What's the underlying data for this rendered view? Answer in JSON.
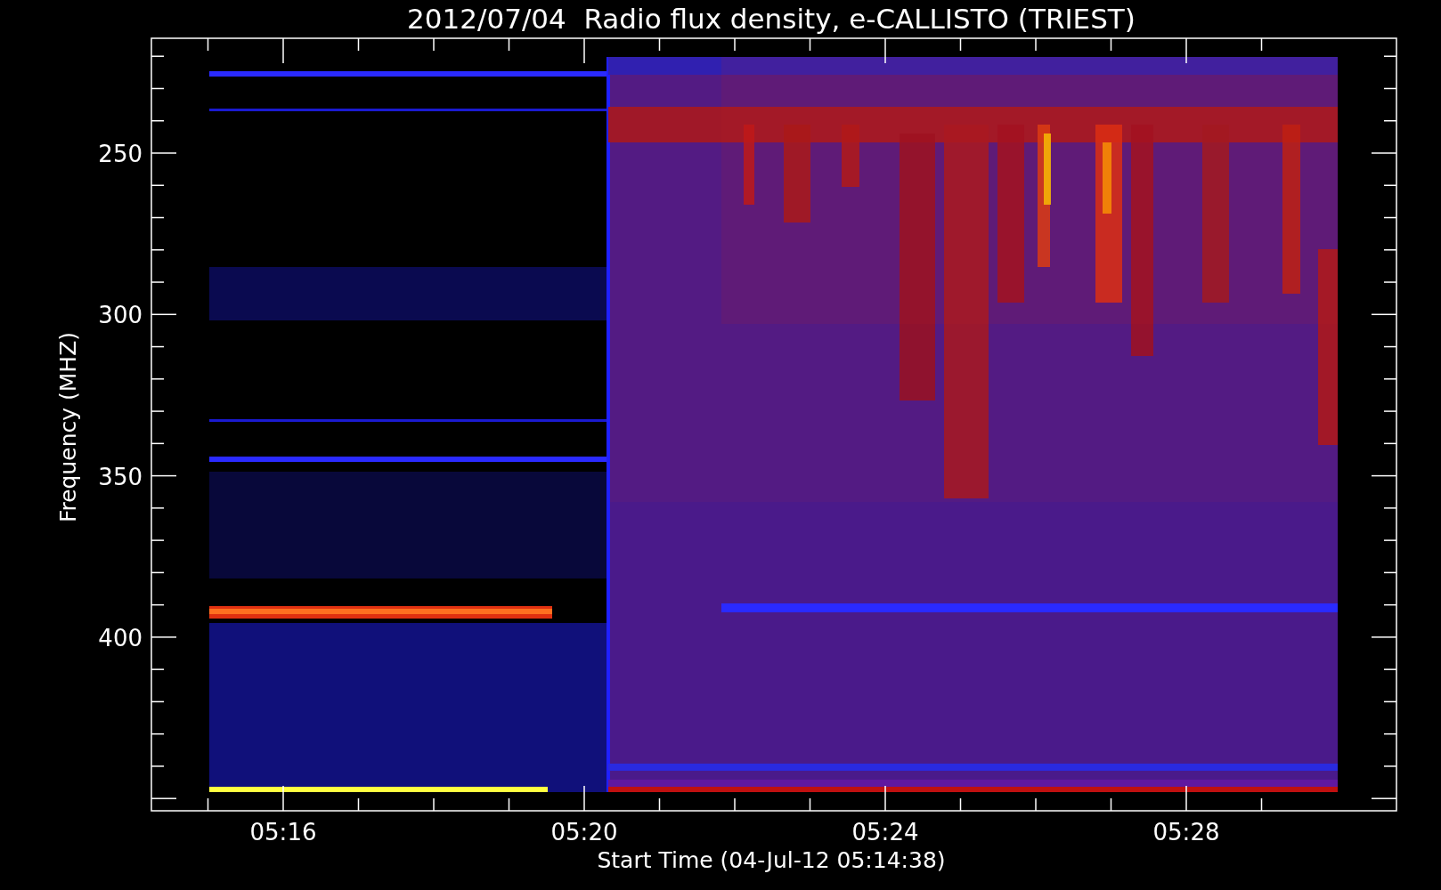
{
  "title": "2012/07/04  Radio flux density, e-CALLISTO (TRIEST)",
  "y_axis": {
    "label": "Frequency (MHZ)",
    "ticks": [
      "250",
      "300",
      "350",
      "400"
    ]
  },
  "x_axis": {
    "label": "Start Time (04-Jul-12 05:14:38)",
    "ticks": [
      "05:16",
      "05:20",
      "05:24",
      "05:28"
    ]
  }
}
